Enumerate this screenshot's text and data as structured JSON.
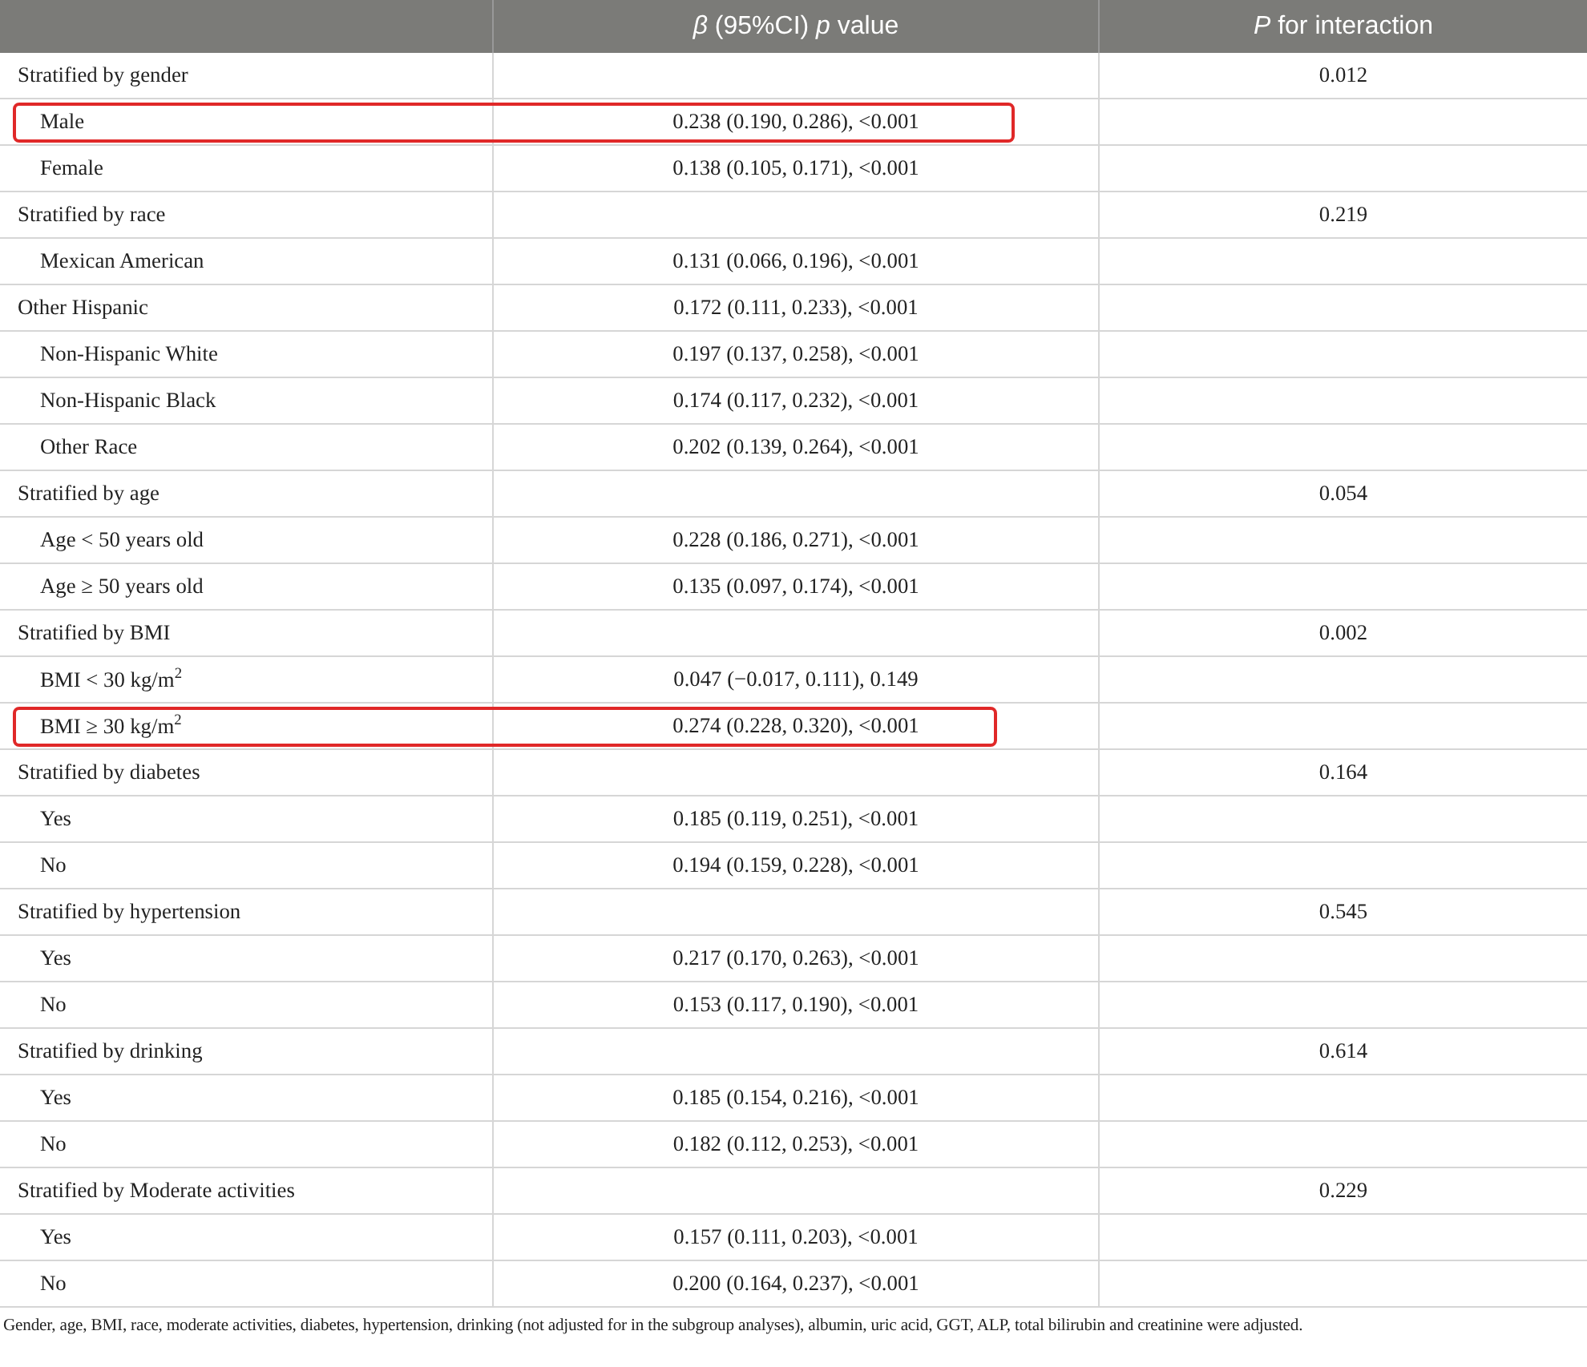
{
  "table": {
    "columns": [
      "",
      "*β* (95%CI) *p* value",
      "*P* for interaction"
    ],
    "rows": [
      {
        "kind": "group",
        "label": "Stratified by gender",
        "estimate": "",
        "p_interaction": "0.012",
        "highlighted": false
      },
      {
        "kind": "sub",
        "label": "Male",
        "estimate": "0.238 (0.190, 0.286), <0.001",
        "p_interaction": "",
        "highlighted": true
      },
      {
        "kind": "sub",
        "label": "Female",
        "estimate": "0.138 (0.105, 0.171), <0.001",
        "p_interaction": "",
        "highlighted": false
      },
      {
        "kind": "group",
        "label": "Stratified by race",
        "estimate": "",
        "p_interaction": "0.219",
        "highlighted": false
      },
      {
        "kind": "sub",
        "label": "Mexican American",
        "estimate": "0.131 (0.066, 0.196), <0.001",
        "p_interaction": "",
        "highlighted": false
      },
      {
        "kind": "group",
        "label": "Other Hispanic",
        "estimate": "0.172 (0.111, 0.233), <0.001",
        "p_interaction": "",
        "highlighted": false
      },
      {
        "kind": "sub",
        "label": "Non-Hispanic White",
        "estimate": "0.197 (0.137, 0.258), <0.001",
        "p_interaction": "",
        "highlighted": false
      },
      {
        "kind": "sub",
        "label": "Non-Hispanic Black",
        "estimate": "0.174 (0.117, 0.232), <0.001",
        "p_interaction": "",
        "highlighted": false
      },
      {
        "kind": "sub",
        "label": "Other Race",
        "estimate": "0.202 (0.139, 0.264), <0.001",
        "p_interaction": "",
        "highlighted": false
      },
      {
        "kind": "group",
        "label": "Stratified by age",
        "estimate": "",
        "p_interaction": "0.054",
        "highlighted": false
      },
      {
        "kind": "sub",
        "label": "Age < 50 years old",
        "estimate": "0.228 (0.186, 0.271), <0.001",
        "p_interaction": "",
        "highlighted": false
      },
      {
        "kind": "sub",
        "label": "Age ≥ 50 years old",
        "estimate": "0.135 (0.097, 0.174), <0.001",
        "p_interaction": "",
        "highlighted": false
      },
      {
        "kind": "group",
        "label": "Stratified by BMI",
        "estimate": "",
        "p_interaction": "0.002",
        "highlighted": false
      },
      {
        "kind": "sub",
        "label": "BMI < 30 kg/m$^{2}$",
        "estimate": "0.047 (−0.017, 0.111), 0.149",
        "p_interaction": "",
        "highlighted": false
      },
      {
        "kind": "sub",
        "label": "BMI ≥ 30 kg/m$^{2}$",
        "estimate": "0.274 (0.228, 0.320), <0.001",
        "p_interaction": "",
        "highlighted": true
      },
      {
        "kind": "group",
        "label": "Stratified by diabetes",
        "estimate": "",
        "p_interaction": "0.164",
        "highlighted": false
      },
      {
        "kind": "sub",
        "label": "Yes",
        "estimate": "0.185 (0.119, 0.251), <0.001",
        "p_interaction": "",
        "highlighted": false
      },
      {
        "kind": "sub",
        "label": "No",
        "estimate": "0.194 (0.159, 0.228), <0.001",
        "p_interaction": "",
        "highlighted": false
      },
      {
        "kind": "group",
        "label": "Stratified by hypertension",
        "estimate": "",
        "p_interaction": "0.545",
        "highlighted": false
      },
      {
        "kind": "sub",
        "label": "Yes",
        "estimate": "0.217 (0.170, 0.263), <0.001",
        "p_interaction": "",
        "highlighted": false
      },
      {
        "kind": "sub",
        "label": "No",
        "estimate": "0.153 (0.117, 0.190), <0.001",
        "p_interaction": "",
        "highlighted": false
      },
      {
        "kind": "group",
        "label": "Stratified by drinking",
        "estimate": "",
        "p_interaction": "0.614",
        "highlighted": false
      },
      {
        "kind": "sub",
        "label": "Yes",
        "estimate": "0.185 (0.154, 0.216), <0.001",
        "p_interaction": "",
        "highlighted": false
      },
      {
        "kind": "sub",
        "label": "No",
        "estimate": "0.182 (0.112, 0.253), <0.001",
        "p_interaction": "",
        "highlighted": false
      },
      {
        "kind": "group",
        "label": "Stratified by Moderate activities",
        "estimate": "",
        "p_interaction": "0.229",
        "highlighted": false
      },
      {
        "kind": "sub",
        "label": "Yes",
        "estimate": "0.157 (0.111, 0.203), <0.001",
        "p_interaction": "",
        "highlighted": false
      },
      {
        "kind": "sub",
        "label": "No",
        "estimate": "0.200 (0.164, 0.237), <0.001",
        "p_interaction": "",
        "highlighted": false
      }
    ]
  },
  "footnote": "Gender, age, BMI, race, moderate activities, diabetes, hypertension, drinking (not adjusted for in the subgroup analyses), albumin, uric acid, GGT, ALP, total bilirubin and creatinine were adjusted."
}
